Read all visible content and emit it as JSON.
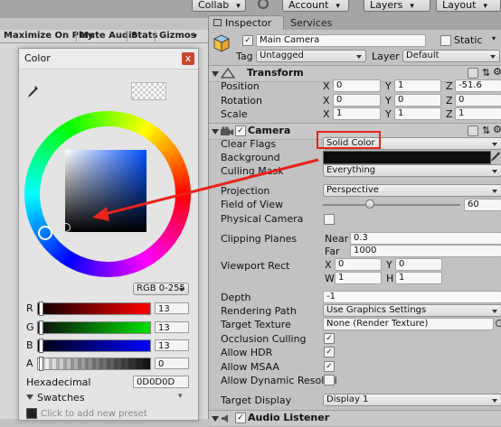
{
  "topbar": {
    "collab": "Collab",
    "account": "Account",
    "layers": "Layers",
    "layout": "Layout"
  },
  "tabs": {
    "inspector": "Inspector",
    "services": "Services"
  },
  "game_toolbar": {
    "maximize": "Maximize On Play",
    "mute": "Mute Audio",
    "stats": "Stats",
    "gizmos": "Gizmos"
  },
  "color_window": {
    "title": "Color",
    "close": "x",
    "mode": "RGB 0-255",
    "channels": [
      {
        "label": "R",
        "value": "13",
        "color": "#ff0000"
      },
      {
        "label": "G",
        "value": "13",
        "color": "#00e000"
      },
      {
        "label": "B",
        "value": "13",
        "color": "#0000ff"
      },
      {
        "label": "A",
        "value": "0",
        "color": "#888888"
      }
    ],
    "hex_label": "Hexadecimal",
    "hex_value": "0D0D0D",
    "swatches": "Swatches",
    "add_preset": "Click to add new preset"
  },
  "object": {
    "name": "Main Camera",
    "static": "Static",
    "tag_label": "Tag",
    "tag": "Untagged",
    "layer_label": "Layer",
    "layer": "Default"
  },
  "transform": {
    "title": "Transform",
    "rows": [
      {
        "label": "Position",
        "x": "0",
        "y": "1",
        "z": "-51.6"
      },
      {
        "label": "Rotation",
        "x": "0",
        "y": "0",
        "z": "0"
      },
      {
        "label": "Scale",
        "x": "1",
        "y": "1",
        "z": "1"
      }
    ],
    "axes": {
      "x": "X",
      "y": "Y",
      "z": "Z"
    }
  },
  "camera": {
    "title": "Camera",
    "clear_flags_label": "Clear Flags",
    "clear_flags": "Solid Color",
    "background_label": "Background",
    "background_color": "#0d0d0d",
    "culling_mask_label": "Culling Mask",
    "culling_mask": "Everything",
    "projection_label": "Projection",
    "projection": "Perspective",
    "fov_label": "Field of View",
    "fov": "60",
    "physical_label": "Physical Camera",
    "clipping_label": "Clipping Planes",
    "near_label": "Near",
    "near": "0.3",
    "far_label": "Far",
    "far": "1000",
    "viewport_label": "Viewport Rect",
    "viewport": {
      "x": "0",
      "y": "0",
      "w": "1",
      "h": "1",
      "x_label": "X",
      "y_label": "Y",
      "w_label": "W",
      "h_label": "H"
    },
    "depth_label": "Depth",
    "depth": "-1",
    "render_path_label": "Rendering Path",
    "render_path": "Use Graphics Settings",
    "target_texture_label": "Target Texture",
    "target_texture": "None (Render Texture)",
    "occlusion_label": "Occlusion Culling",
    "hdr_label": "Allow HDR",
    "msaa_label": "Allow MSAA",
    "dyn_res_label": "Allow Dynamic Resoluti",
    "target_display_label": "Target Display",
    "target_display": "Display 1"
  },
  "audio_listener": {
    "title": "Audio Listener"
  },
  "highlight_color": "#e8231c",
  "check_mark": "✓"
}
